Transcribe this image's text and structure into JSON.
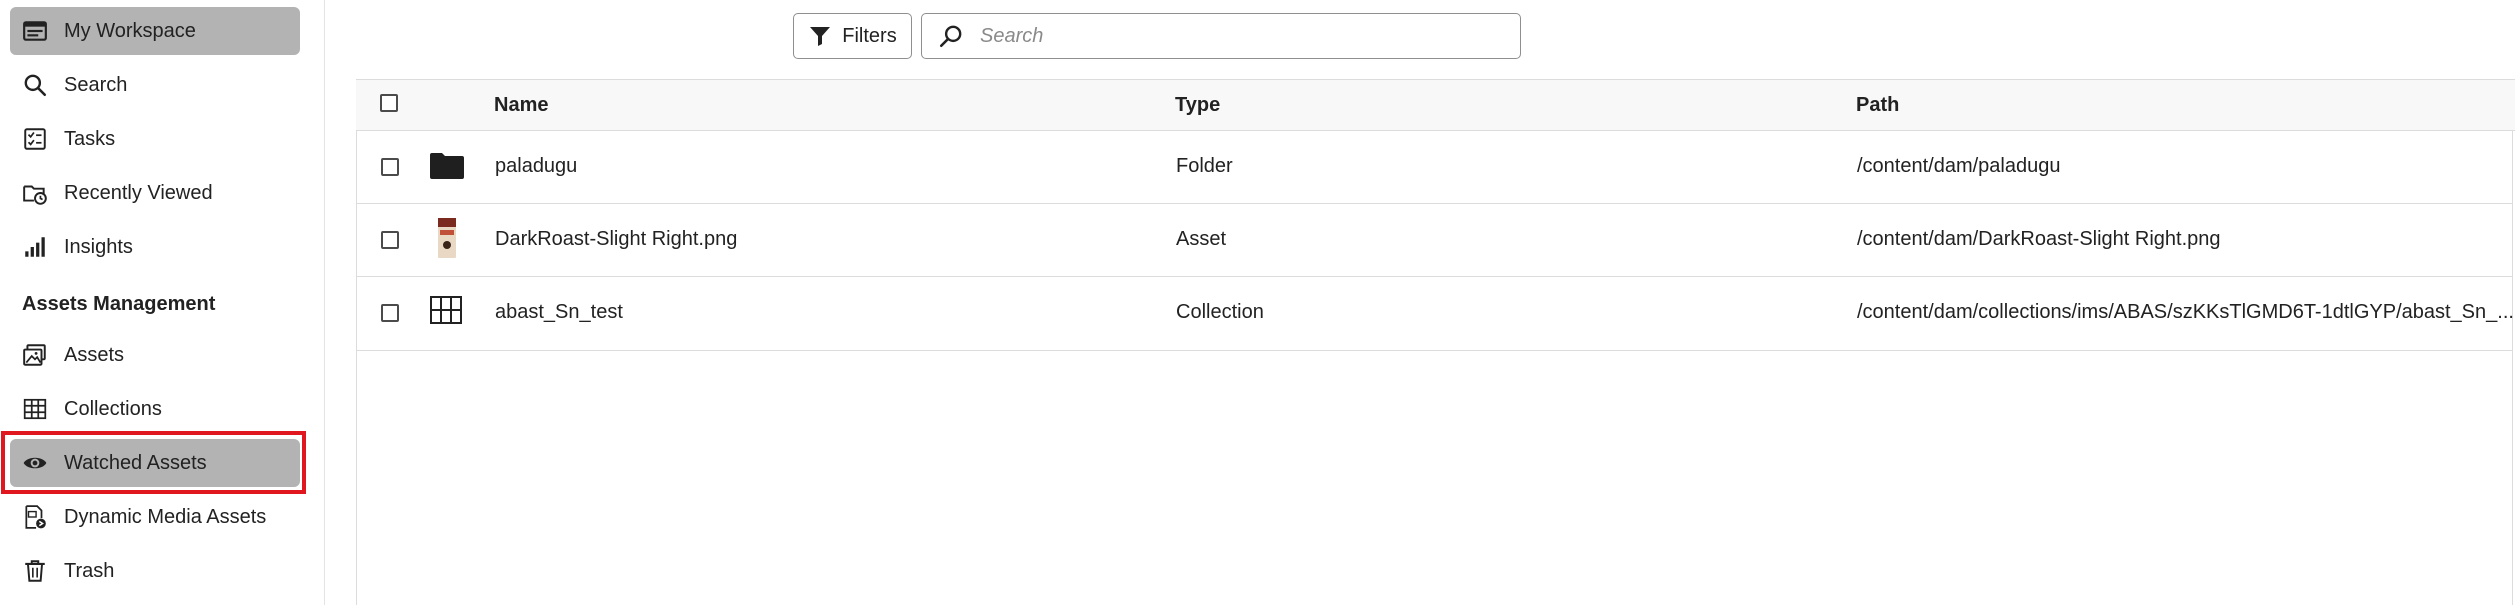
{
  "sidebar": {
    "items": [
      {
        "label": "My Workspace",
        "icon": "workspace-icon",
        "active": true
      },
      {
        "label": "Search",
        "icon": "search-icon"
      },
      {
        "label": "Tasks",
        "icon": "tasks-icon"
      },
      {
        "label": "Recently Viewed",
        "icon": "recently-viewed-icon"
      },
      {
        "label": "Insights",
        "icon": "insights-icon"
      }
    ],
    "section_title": "Assets Management",
    "section_items": [
      {
        "label": "Assets",
        "icon": "assets-icon"
      },
      {
        "label": "Collections",
        "icon": "collections-icon"
      },
      {
        "label": "Watched Assets",
        "icon": "eye-icon",
        "active": true,
        "highlighted": true
      },
      {
        "label": "Dynamic Media Assets",
        "icon": "dynamic-media-icon"
      },
      {
        "label": "Trash",
        "icon": "trash-icon"
      }
    ]
  },
  "toolbar": {
    "filters_label": "Filters",
    "search_placeholder": "Search"
  },
  "table": {
    "columns": [
      "Name",
      "Type",
      "Path"
    ],
    "rows": [
      {
        "name": "paladugu",
        "type": "Folder",
        "path": "/content/dam/paladugu",
        "thumb": "folder-icon"
      },
      {
        "name": "DarkRoast-Slight Right.png",
        "type": "Asset",
        "path": "/content/dam/DarkRoast-Slight Right.png",
        "thumb": "image-thumbnail"
      },
      {
        "name": "abast_Sn_test",
        "type": "Collection",
        "path": "/content/dam/collections/ims/ABAS/szKKsTlGMD6T-1dtlGYP/abast_Sn_...",
        "thumb": "collection-grid-icon"
      }
    ]
  },
  "colors": {
    "active_bg": "#b3b3b3",
    "highlight_border": "#e0171f",
    "header_bg": "#f8f8f8"
  }
}
